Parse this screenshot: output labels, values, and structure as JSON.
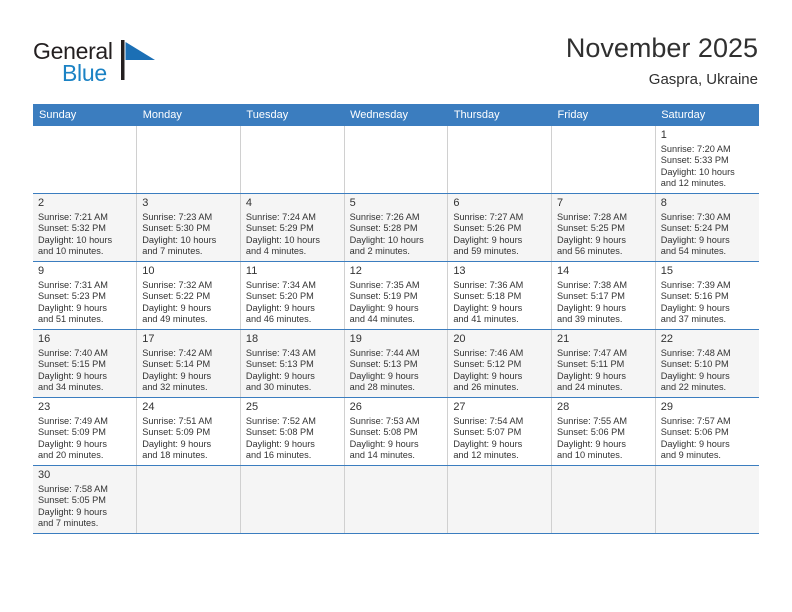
{
  "brand": {
    "name_top": "General",
    "name_bottom": "Blue",
    "mark": "triangle-flag-icon",
    "color_dark": "#231f20",
    "color_blue": "#1b82c4"
  },
  "header": {
    "title": "November 2025",
    "location": "Gaspra, Ukraine"
  },
  "theme": {
    "header_row_bg": "#3b7dbf",
    "header_row_text": "#ffffff",
    "row_separator": "#3b7dbf",
    "alt_cell_bg": "#f5f5f5",
    "text": "#333333"
  },
  "weekday_headers": [
    "Sunday",
    "Monday",
    "Tuesday",
    "Wednesday",
    "Thursday",
    "Friday",
    "Saturday"
  ],
  "weeks": [
    [
      {
        "day": "",
        "info": "",
        "empty": true
      },
      {
        "day": "",
        "info": "",
        "empty": true
      },
      {
        "day": "",
        "info": "",
        "empty": true
      },
      {
        "day": "",
        "info": "",
        "empty": true
      },
      {
        "day": "",
        "info": "",
        "empty": true
      },
      {
        "day": "",
        "info": "",
        "empty": true
      },
      {
        "day": "1",
        "sunrise": "7:20 AM",
        "sunset": "5:33 PM",
        "daylight": "10 hours and 12 minutes.",
        "info": "Sunrise: 7:20 AM\nSunset: 5:33 PM\nDaylight: 10 hours\nand 12 minutes."
      }
    ],
    [
      {
        "day": "2",
        "sunrise": "7:21 AM",
        "sunset": "5:32 PM",
        "daylight": "10 hours and 10 minutes.",
        "info": "Sunrise: 7:21 AM\nSunset: 5:32 PM\nDaylight: 10 hours\nand 10 minutes."
      },
      {
        "day": "3",
        "sunrise": "7:23 AM",
        "sunset": "5:30 PM",
        "daylight": "10 hours and 7 minutes.",
        "info": "Sunrise: 7:23 AM\nSunset: 5:30 PM\nDaylight: 10 hours\nand 7 minutes."
      },
      {
        "day": "4",
        "sunrise": "7:24 AM",
        "sunset": "5:29 PM",
        "daylight": "10 hours and 4 minutes.",
        "info": "Sunrise: 7:24 AM\nSunset: 5:29 PM\nDaylight: 10 hours\nand 4 minutes."
      },
      {
        "day": "5",
        "sunrise": "7:26 AM",
        "sunset": "5:28 PM",
        "daylight": "10 hours and 2 minutes.",
        "info": "Sunrise: 7:26 AM\nSunset: 5:28 PM\nDaylight: 10 hours\nand 2 minutes."
      },
      {
        "day": "6",
        "sunrise": "7:27 AM",
        "sunset": "5:26 PM",
        "daylight": "9 hours and 59 minutes.",
        "info": "Sunrise: 7:27 AM\nSunset: 5:26 PM\nDaylight: 9 hours\nand 59 minutes."
      },
      {
        "day": "7",
        "sunrise": "7:28 AM",
        "sunset": "5:25 PM",
        "daylight": "9 hours and 56 minutes.",
        "info": "Sunrise: 7:28 AM\nSunset: 5:25 PM\nDaylight: 9 hours\nand 56 minutes."
      },
      {
        "day": "8",
        "sunrise": "7:30 AM",
        "sunset": "5:24 PM",
        "daylight": "9 hours and 54 minutes.",
        "info": "Sunrise: 7:30 AM\nSunset: 5:24 PM\nDaylight: 9 hours\nand 54 minutes."
      }
    ],
    [
      {
        "day": "9",
        "sunrise": "7:31 AM",
        "sunset": "5:23 PM",
        "daylight": "9 hours and 51 minutes.",
        "info": "Sunrise: 7:31 AM\nSunset: 5:23 PM\nDaylight: 9 hours\nand 51 minutes."
      },
      {
        "day": "10",
        "sunrise": "7:32 AM",
        "sunset": "5:22 PM",
        "daylight": "9 hours and 49 minutes.",
        "info": "Sunrise: 7:32 AM\nSunset: 5:22 PM\nDaylight: 9 hours\nand 49 minutes."
      },
      {
        "day": "11",
        "sunrise": "7:34 AM",
        "sunset": "5:20 PM",
        "daylight": "9 hours and 46 minutes.",
        "info": "Sunrise: 7:34 AM\nSunset: 5:20 PM\nDaylight: 9 hours\nand 46 minutes."
      },
      {
        "day": "12",
        "sunrise": "7:35 AM",
        "sunset": "5:19 PM",
        "daylight": "9 hours and 44 minutes.",
        "info": "Sunrise: 7:35 AM\nSunset: 5:19 PM\nDaylight: 9 hours\nand 44 minutes."
      },
      {
        "day": "13",
        "sunrise": "7:36 AM",
        "sunset": "5:18 PM",
        "daylight": "9 hours and 41 minutes.",
        "info": "Sunrise: 7:36 AM\nSunset: 5:18 PM\nDaylight: 9 hours\nand 41 minutes."
      },
      {
        "day": "14",
        "sunrise": "7:38 AM",
        "sunset": "5:17 PM",
        "daylight": "9 hours and 39 minutes.",
        "info": "Sunrise: 7:38 AM\nSunset: 5:17 PM\nDaylight: 9 hours\nand 39 minutes."
      },
      {
        "day": "15",
        "sunrise": "7:39 AM",
        "sunset": "5:16 PM",
        "daylight": "9 hours and 37 minutes.",
        "info": "Sunrise: 7:39 AM\nSunset: 5:16 PM\nDaylight: 9 hours\nand 37 minutes."
      }
    ],
    [
      {
        "day": "16",
        "sunrise": "7:40 AM",
        "sunset": "5:15 PM",
        "daylight": "9 hours and 34 minutes.",
        "info": "Sunrise: 7:40 AM\nSunset: 5:15 PM\nDaylight: 9 hours\nand 34 minutes."
      },
      {
        "day": "17",
        "sunrise": "7:42 AM",
        "sunset": "5:14 PM",
        "daylight": "9 hours and 32 minutes.",
        "info": "Sunrise: 7:42 AM\nSunset: 5:14 PM\nDaylight: 9 hours\nand 32 minutes."
      },
      {
        "day": "18",
        "sunrise": "7:43 AM",
        "sunset": "5:13 PM",
        "daylight": "9 hours and 30 minutes.",
        "info": "Sunrise: 7:43 AM\nSunset: 5:13 PM\nDaylight: 9 hours\nand 30 minutes."
      },
      {
        "day": "19",
        "sunrise": "7:44 AM",
        "sunset": "5:13 PM",
        "daylight": "9 hours and 28 minutes.",
        "info": "Sunrise: 7:44 AM\nSunset: 5:13 PM\nDaylight: 9 hours\nand 28 minutes."
      },
      {
        "day": "20",
        "sunrise": "7:46 AM",
        "sunset": "5:12 PM",
        "daylight": "9 hours and 26 minutes.",
        "info": "Sunrise: 7:46 AM\nSunset: 5:12 PM\nDaylight: 9 hours\nand 26 minutes."
      },
      {
        "day": "21",
        "sunrise": "7:47 AM",
        "sunset": "5:11 PM",
        "daylight": "9 hours and 24 minutes.",
        "info": "Sunrise: 7:47 AM\nSunset: 5:11 PM\nDaylight: 9 hours\nand 24 minutes."
      },
      {
        "day": "22",
        "sunrise": "7:48 AM",
        "sunset": "5:10 PM",
        "daylight": "9 hours and 22 minutes.",
        "info": "Sunrise: 7:48 AM\nSunset: 5:10 PM\nDaylight: 9 hours\nand 22 minutes."
      }
    ],
    [
      {
        "day": "23",
        "sunrise": "7:49 AM",
        "sunset": "5:09 PM",
        "daylight": "9 hours and 20 minutes.",
        "info": "Sunrise: 7:49 AM\nSunset: 5:09 PM\nDaylight: 9 hours\nand 20 minutes."
      },
      {
        "day": "24",
        "sunrise": "7:51 AM",
        "sunset": "5:09 PM",
        "daylight": "9 hours and 18 minutes.",
        "info": "Sunrise: 7:51 AM\nSunset: 5:09 PM\nDaylight: 9 hours\nand 18 minutes."
      },
      {
        "day": "25",
        "sunrise": "7:52 AM",
        "sunset": "5:08 PM",
        "daylight": "9 hours and 16 minutes.",
        "info": "Sunrise: 7:52 AM\nSunset: 5:08 PM\nDaylight: 9 hours\nand 16 minutes."
      },
      {
        "day": "26",
        "sunrise": "7:53 AM",
        "sunset": "5:08 PM",
        "daylight": "9 hours and 14 minutes.",
        "info": "Sunrise: 7:53 AM\nSunset: 5:08 PM\nDaylight: 9 hours\nand 14 minutes."
      },
      {
        "day": "27",
        "sunrise": "7:54 AM",
        "sunset": "5:07 PM",
        "daylight": "9 hours and 12 minutes.",
        "info": "Sunrise: 7:54 AM\nSunset: 5:07 PM\nDaylight: 9 hours\nand 12 minutes."
      },
      {
        "day": "28",
        "sunrise": "7:55 AM",
        "sunset": "5:06 PM",
        "daylight": "9 hours and 10 minutes.",
        "info": "Sunrise: 7:55 AM\nSunset: 5:06 PM\nDaylight: 9 hours\nand 10 minutes."
      },
      {
        "day": "29",
        "sunrise": "7:57 AM",
        "sunset": "5:06 PM",
        "daylight": "9 hours and 9 minutes.",
        "info": "Sunrise: 7:57 AM\nSunset: 5:06 PM\nDaylight: 9 hours\nand 9 minutes."
      }
    ],
    [
      {
        "day": "30",
        "sunrise": "7:58 AM",
        "sunset": "5:05 PM",
        "daylight": "9 hours and 7 minutes.",
        "info": "Sunrise: 7:58 AM\nSunset: 5:05 PM\nDaylight: 9 hours\nand 7 minutes."
      },
      {
        "day": "",
        "info": "",
        "empty": true
      },
      {
        "day": "",
        "info": "",
        "empty": true
      },
      {
        "day": "",
        "info": "",
        "empty": true
      },
      {
        "day": "",
        "info": "",
        "empty": true
      },
      {
        "day": "",
        "info": "",
        "empty": true
      },
      {
        "day": "",
        "info": "",
        "empty": true
      }
    ]
  ]
}
